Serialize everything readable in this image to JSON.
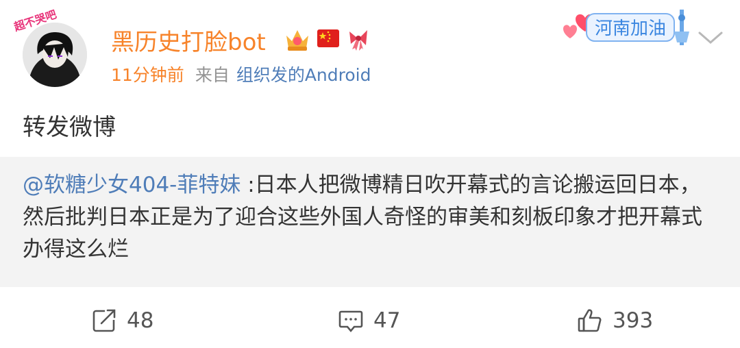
{
  "post": {
    "username": "黑历史打脸bot",
    "time": "11分钟前",
    "from_label": "来自",
    "source": "组织发的Android",
    "avatar_badge": "超不哭吧",
    "decor_text": "河南加油",
    "content": "转发微博"
  },
  "repost": {
    "mention": "@软糖少女404-菲特妹",
    "text": " :日本人把微博精日吹开幕式的言论搬运回日本，然后批判日本正是为了迎合这些外国人奇怪的审美和刻板印象才把开幕式办得这么烂"
  },
  "actions": {
    "reposts": "48",
    "comments": "47",
    "likes": "393"
  },
  "icons": [
    "crown-vip-icon",
    "china-flag-icon",
    "ribbon-icon",
    "chevron-down-icon",
    "repost-icon",
    "comment-icon",
    "like-icon"
  ],
  "colors": {
    "username": "#f7832a",
    "link": "#4f7db8",
    "repost_bg": "#f3f3f3"
  }
}
